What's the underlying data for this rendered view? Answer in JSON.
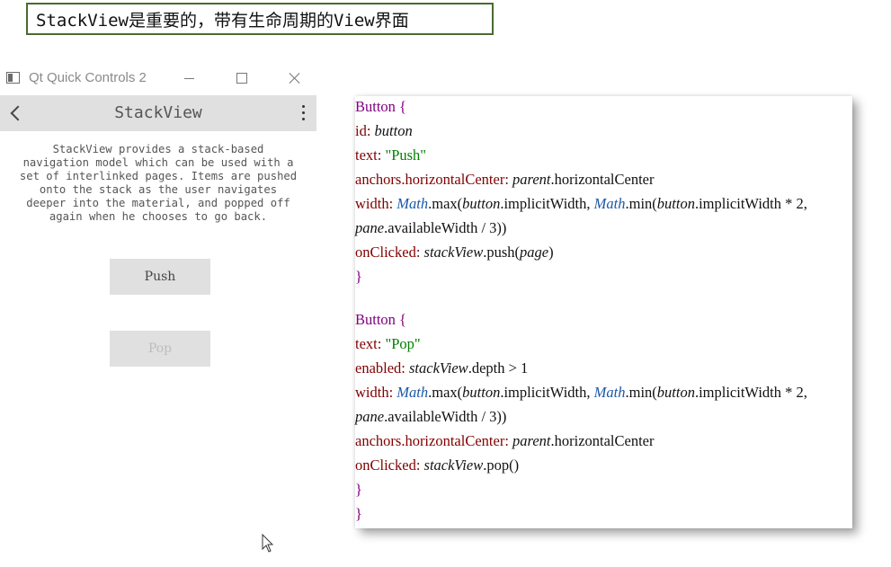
{
  "banner": {
    "text": "StackView是重要的，带有生命周期的View界面"
  },
  "window": {
    "title": "Qt Quick Controls 2",
    "toolbar_title": "StackView",
    "description_lines": [
      "StackView provides a stack-based",
      "navigation model which can be used with a",
      "set of interlinked pages. Items are pushed",
      "onto the stack as the user navigates",
      "deeper into the material, and popped off",
      "again when he chooses to go back."
    ],
    "push_label": "Push",
    "pop_label": "Pop",
    "pop_enabled": false
  },
  "code": {
    "push_button": {
      "l1": "Button {",
      "l2_key": "id: ",
      "l2_val": "button",
      "l3_key": "text: ",
      "l3_val": "\"Push\"",
      "l4_key": "anchors.horizontalCenter: ",
      "l4_obj": "parent",
      "l4_rest": ".horizontalCenter",
      "l5_key": "width: ",
      "l5_math1": "Math",
      "l5_a": ".max(",
      "l5_btn1": "button",
      "l5_b": ".implicitWidth, ",
      "l5_math2": "Math",
      "l5_c": ".min(",
      "l5_btn2": "button",
      "l5_d": ".implicitWidth * 2,",
      "l6_pane": "pane",
      "l6_rest": ".availableWidth / 3))",
      "l7_key": "onClicked: ",
      "l7_obj": "stackView",
      "l7_a": ".push(",
      "l7_arg": "page",
      "l7_b": ")",
      "l8": "}"
    },
    "pop_button": {
      "l1": "Button {",
      "l2_key": "text: ",
      "l2_val": "\"Pop\"",
      "l3_key": "enabled: ",
      "l3_obj": "stackView",
      "l3_rest": ".depth > 1",
      "l4_key": "width: ",
      "l4_math1": "Math",
      "l4_a": ".max(",
      "l4_btn1": "button",
      "l4_b": ".implicitWidth, ",
      "l4_math2": "Math",
      "l4_c": ".min(",
      "l4_btn2": "button",
      "l4_d": ".implicitWidth * 2,",
      "l5_pane": "pane",
      "l5_rest": ".availableWidth / 3))",
      "l6_key": "anchors.horizontalCenter: ",
      "l6_obj": "parent",
      "l6_rest": ".horizontalCenter",
      "l7_key": "onClicked: ",
      "l7_obj": "stackView",
      "l7_rest": ".pop()",
      "l8": "}",
      "l9": "}"
    }
  },
  "icons": {
    "app": "app-window-icon",
    "back": "back-arrow-icon",
    "menu": "more-vert-icon",
    "cursor": "mouse-pointer-icon"
  }
}
